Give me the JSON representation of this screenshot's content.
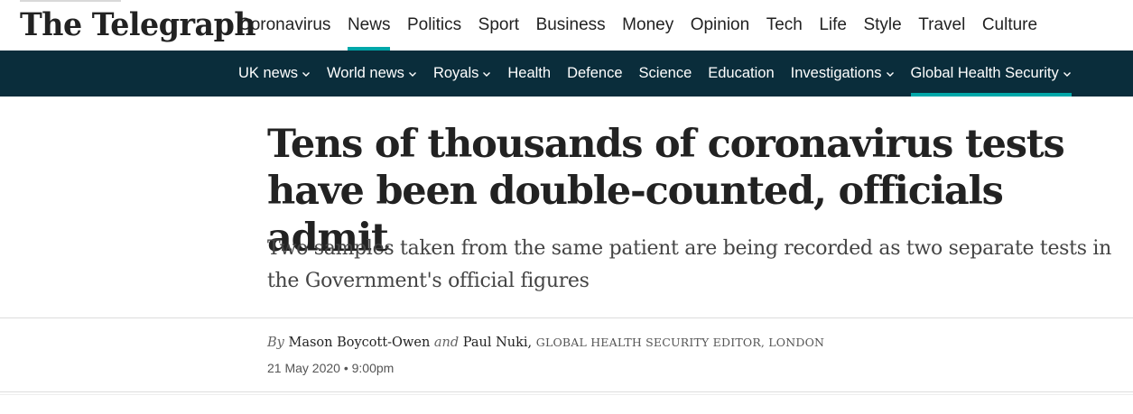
{
  "brand": {
    "logo_text": "The Telegraph"
  },
  "main_nav": {
    "items": [
      {
        "label": "Coronavirus"
      },
      {
        "label": "News",
        "active": true
      },
      {
        "label": "Politics"
      },
      {
        "label": "Sport"
      },
      {
        "label": "Business"
      },
      {
        "label": "Money"
      },
      {
        "label": "Opinion"
      },
      {
        "label": "Tech"
      },
      {
        "label": "Life"
      },
      {
        "label": "Style"
      },
      {
        "label": "Travel"
      },
      {
        "label": "Culture"
      }
    ]
  },
  "sub_nav": {
    "items": [
      {
        "label": "UK news",
        "has_dropdown": true
      },
      {
        "label": "World news",
        "has_dropdown": true
      },
      {
        "label": "Royals",
        "has_dropdown": true
      },
      {
        "label": "Health",
        "has_dropdown": false
      },
      {
        "label": "Defence",
        "has_dropdown": false
      },
      {
        "label": "Science",
        "has_dropdown": false
      },
      {
        "label": "Education",
        "has_dropdown": false
      },
      {
        "label": "Investigations",
        "has_dropdown": true
      },
      {
        "label": "Global Health Security",
        "has_dropdown": true,
        "active": true
      }
    ]
  },
  "article": {
    "headline": "Tens of thousands of coronavirus tests have been double-counted, officials admit",
    "standfirst": "Two samples taken from the same patient are being recorded as two separate tests in the Government's official figures",
    "byline": {
      "by": "By",
      "author1": "Mason Boycott-Owen",
      "and": "and",
      "author2": "Paul Nuki,",
      "role": "GLOBAL HEALTH SECURITY EDITOR, LONDON"
    },
    "date": "21 May 2020 • 9:00pm"
  },
  "colors": {
    "accent": "#00a7a9",
    "subnav_bg": "#0a2d3b",
    "text": "#222222"
  },
  "icons": {
    "dropdown": "chevron-down-icon"
  }
}
